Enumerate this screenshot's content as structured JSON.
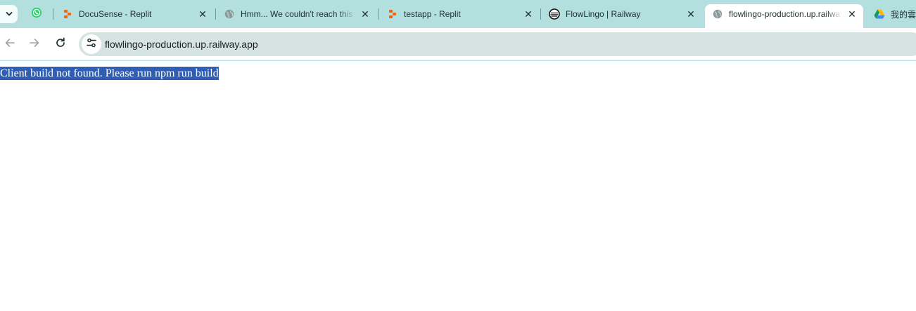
{
  "tabs": [
    {
      "title": "DocuSense - Replit",
      "favicon": "replit-icon"
    },
    {
      "title": "Hmm... We couldn't reach this page",
      "favicon": "globe-icon"
    },
    {
      "title": "testapp - Replit",
      "favicon": "replit-icon"
    },
    {
      "title": "FlowLingo | Railway",
      "favicon": "railway-icon"
    },
    {
      "title": "flowlingo-production.up.railway.app",
      "favicon": "globe-icon",
      "active": true
    },
    {
      "title": "我的雲端硬碟",
      "favicon": "google-drive-icon"
    }
  ],
  "pinned_tab": {
    "favicon": "whatsapp-icon"
  },
  "address_bar": {
    "url": "flowlingo-production.up.railway.app"
  },
  "page": {
    "message": "Client build not found. Please run npm run build"
  },
  "colors": {
    "tabstrip": "#b3dfdf",
    "omnibox": "#d6e3e3",
    "selection": "#2e5fb4"
  }
}
